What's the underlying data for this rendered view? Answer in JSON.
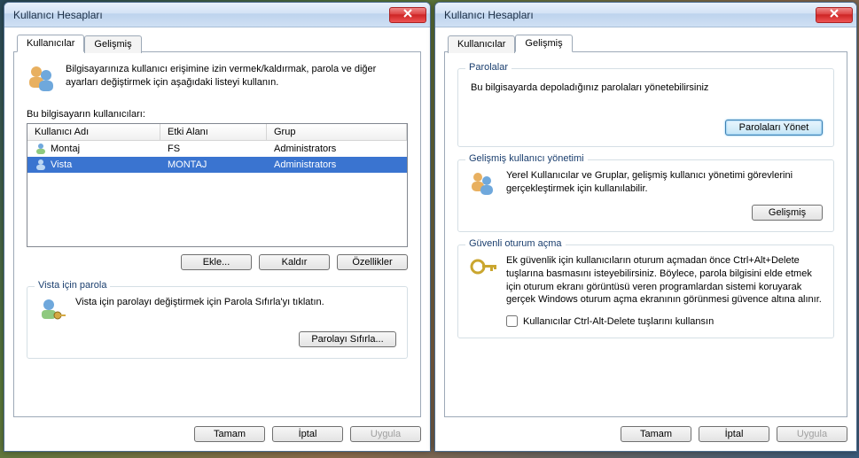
{
  "left": {
    "title": "Kullanıcı Hesapları",
    "tabs": {
      "users": "Kullanıcılar",
      "advanced": "Gelişmiş"
    },
    "intro": "Bilgisayarınıza kullanıcı erişimine izin vermek/kaldırmak, parola ve diğer ayarları değiştirmek için aşağıdaki listeyi kullanın.",
    "list_label": "Bu bilgisayarın kullanıcıları:",
    "columns": {
      "user": "Kullanıcı Adı",
      "domain": "Etki Alanı",
      "group": "Grup"
    },
    "rows": [
      {
        "user": "Montaj",
        "domain": "FS",
        "group": "Administrators"
      },
      {
        "user": "Vista",
        "domain": "MONTAJ",
        "group": "Administrators"
      }
    ],
    "buttons": {
      "add": "Ekle...",
      "remove": "Kaldır",
      "props": "Özellikler"
    },
    "pwgroup": {
      "legend": "Vista için parola",
      "text": "Vista için parolayı değiştirmek için Parola Sıfırla'yı tıklatın.",
      "reset": "Parolayı Sıfırla..."
    },
    "footer": {
      "ok": "Tamam",
      "cancel": "İptal",
      "apply": "Uygula"
    }
  },
  "right": {
    "title": "Kullanıcı Hesapları",
    "tabs": {
      "users": "Kullanıcılar",
      "advanced": "Gelişmiş"
    },
    "passwords": {
      "legend": "Parolalar",
      "text": "Bu bilgisayarda depoladığınız parolaları yönetebilirsiniz",
      "manage": "Parolaları Yönet"
    },
    "advmgmt": {
      "legend": "Gelişmiş kullanıcı yönetimi",
      "text": "Yerel Kullanıcılar ve Gruplar, gelişmiş kullanıcı yönetimi görevlerini gerçekleştirmek için kullanılabilir.",
      "button": "Gelişmiş"
    },
    "secure": {
      "legend": "Güvenli oturum açma",
      "text": "Ek güvenlik için kullanıcıların oturum açmadan önce Ctrl+Alt+Delete tuşlarına basmasını isteyebilirsiniz. Böylece, parola bilgisini elde etmek için oturum ekranı görüntüsü veren programlardan sistemi koruyarak gerçek Windows oturum açma ekranının görünmesi güvence altına alınır.",
      "checkbox": "Kullanıcılar Ctrl-Alt-Delete tuşlarını kullansın"
    },
    "footer": {
      "ok": "Tamam",
      "cancel": "İptal",
      "apply": "Uygula"
    }
  }
}
